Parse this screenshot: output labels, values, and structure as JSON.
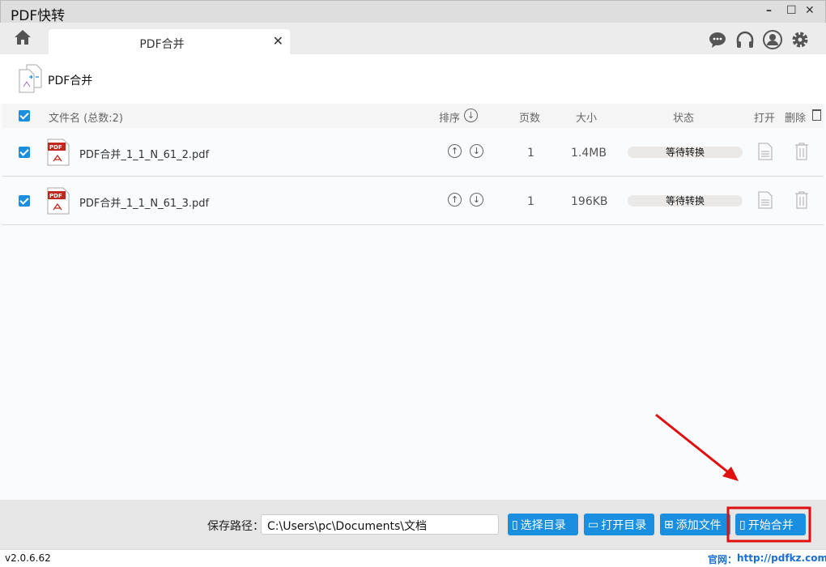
{
  "app": {
    "title": "PDF快转",
    "version": "v2.0.6.62"
  },
  "tab": {
    "label": "PDF合并"
  },
  "page": {
    "title": "PDF合并"
  },
  "table": {
    "headers": {
      "name": "文件名 (总数:2)",
      "sort": "排序",
      "pages": "页数",
      "size": "大小",
      "status": "状态",
      "open": "打开",
      "delete": "删除"
    },
    "rows": [
      {
        "name": "PDF合并_1_1_N_61_2.pdf",
        "pages": "1",
        "size": "1.4MB",
        "status": "等待转换"
      },
      {
        "name": "PDF合并_1_1_N_61_3.pdf",
        "pages": "1",
        "size": "196KB",
        "status": "等待转换"
      }
    ]
  },
  "bottom": {
    "path_label": "保存路径：",
    "path_value": "C:\\Users\\pc\\Documents\\文档",
    "choose_dir": "选择目录",
    "open_dir": "打开目录",
    "add_file": "添加文件",
    "start_merge": "开始合并"
  },
  "footer": {
    "site_label": "官网：",
    "site_url": "http://pdfkz.com"
  },
  "colors": {
    "accent": "#1a8fe0",
    "annotation": "#e01010"
  }
}
